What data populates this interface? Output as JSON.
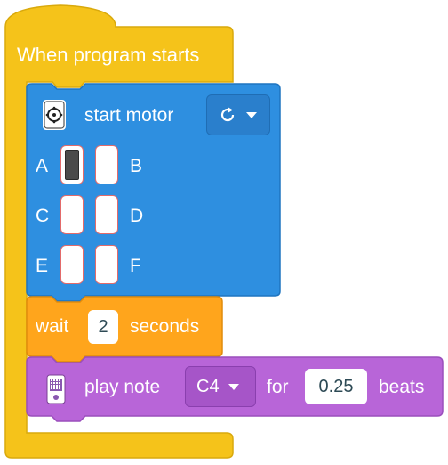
{
  "hat_block": {
    "title": "When program starts",
    "color": "#f5c31a",
    "border": "#d9a90c"
  },
  "motor_block": {
    "icon": "motor-icon",
    "label": "start motor",
    "direction": {
      "icon": "clockwise-arrow-icon"
    },
    "color": "#2e8fe0",
    "ports": [
      {
        "left": "A",
        "right": "B",
        "left_selected": true,
        "right_selected": false
      },
      {
        "left": "C",
        "right": "D",
        "left_selected": false,
        "right_selected": false
      },
      {
        "left": "E",
        "right": "F",
        "left_selected": false,
        "right_selected": false
      }
    ]
  },
  "wait_block": {
    "label_before": "wait",
    "value": "2",
    "label_after": "seconds",
    "color": "#ffa51c"
  },
  "note_block": {
    "icon": "hub-icon",
    "label": "play note",
    "note": "C4",
    "label_mid": "for",
    "duration": "0.25",
    "label_after": "beats",
    "color": "#b865d8"
  }
}
